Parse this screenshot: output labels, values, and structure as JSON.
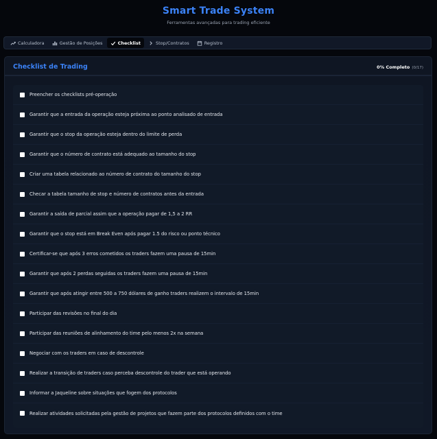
{
  "header": {
    "title": "Smart Trade System",
    "subtitle": "Ferramentas avançadas para trading eficiente"
  },
  "tabs": [
    {
      "label": "Calculadora",
      "icon": "trend-icon",
      "active": false
    },
    {
      "label": "Gestão de Posições",
      "icon": "bar-chart-icon",
      "active": false
    },
    {
      "label": "Checklist",
      "icon": "check-icon",
      "active": true
    },
    {
      "label": "Stop/Contratos",
      "icon": "chevron-right-icon",
      "active": false
    },
    {
      "label": "Registro",
      "icon": "calendar-icon",
      "active": false
    }
  ],
  "checklist": {
    "title": "Checklist de Trading",
    "progress_label": "0% Completo",
    "progress_count": "(0/17)",
    "items": [
      {
        "label": "Preencher os checklists pré-operação",
        "checked": false
      },
      {
        "label": "Garantir que a entrada da operação esteja próxima ao ponto analisado de entrada",
        "checked": false
      },
      {
        "label": "Garantir que o stop da operação esteja dentro do limite de perda",
        "checked": false
      },
      {
        "label": "Garantir que o número de contrato está adequado ao tamanho do stop",
        "checked": false
      },
      {
        "label": "Criar uma tabela relacionado ao número de contrato do tamanho do stop",
        "checked": false
      },
      {
        "label": "Checar a tabela tamanho de stop e número de contratos antes da entrada",
        "checked": false
      },
      {
        "label": "Garantir a saída de parcial assim que a operação pagar de 1,5 a 2 RR",
        "checked": false
      },
      {
        "label": "Garantir que o stop está em Break Even após pagar 1.5 do risco ou ponto técnico",
        "checked": false
      },
      {
        "label": "Certificar-se que após 3 erros cometidos os traders fazem uma pausa de 15min",
        "checked": false
      },
      {
        "label": "Garantir que após 2 perdas seguidas os traders fazem uma pausa de 15min",
        "checked": false
      },
      {
        "label": "Garantir que após atingir entre 500 a 750 dólares de ganho traders realizem o intervalo de 15min",
        "checked": false
      },
      {
        "label": "Participar das revisões no final do dia",
        "checked": false
      },
      {
        "label": "Participar das reuniões de alinhamento do time pelo menos 2x na semana",
        "checked": false
      },
      {
        "label": "Negociar com os traders em caso de descontrole",
        "checked": false
      },
      {
        "label": "Realizar a transição de traders caso perceba descontrole do trader que está operando",
        "checked": false
      },
      {
        "label": "Informar a Jaqueline sobre situações que fogem dos protocolos",
        "checked": false
      },
      {
        "label": "Realizar atividades solicitadas pela gestão de projetos que fazem parte dos protocolos definidos com o time",
        "checked": false
      }
    ]
  },
  "colors": {
    "accent": "#3b82f6",
    "background": "#05070c",
    "card": "#0f1623"
  }
}
